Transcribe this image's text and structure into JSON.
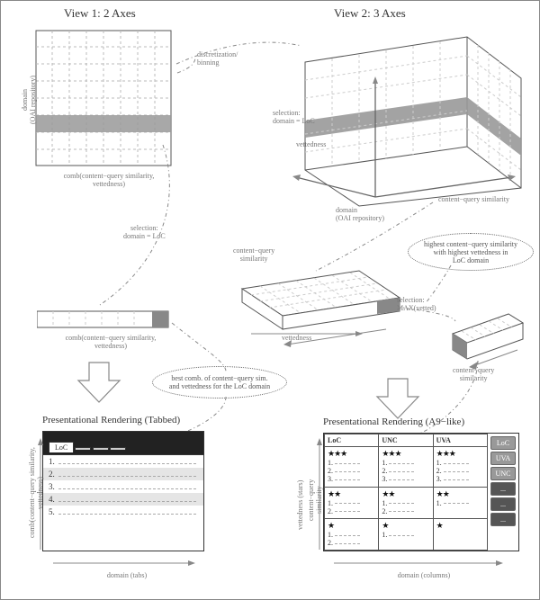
{
  "titles": {
    "view1": "View 1: 2 Axes",
    "view2": "View 2: 3 Axes"
  },
  "labels": {
    "domain_oai": "domain\n(OAI repository)",
    "comb_axis": "comb(content−query similarity,\nvettedness)",
    "discretization": "discretization/\nbinning",
    "selection_loc": "selection:\ndomain = LoC",
    "vettedness": "vettedness",
    "cqsim": "content−query similarity",
    "cqsim_short": "content−query\nsimilarity",
    "sel_max": "selection:\nMAX(vetted)",
    "vetted_stars": "vettedness (stars)",
    "domain_tabs": "domain (tabs)",
    "domain_columns": "domain (columns)",
    "tabbed_title": "Presentational Rendering (Tabbed)",
    "a9_title": "Presentational Rendering (A9−like)"
  },
  "ovals": {
    "best_comb": "best comb. of content−query sim.\nand vettedness for the LoC domain",
    "highest": "highest content−query similarity\nwith highest vettedness in\nLoC domain"
  },
  "tabbed": {
    "tabs": [
      "LoC",
      "",
      "",
      ""
    ],
    "rows": [
      "1.",
      "2.",
      "3.",
      "4.",
      "5."
    ]
  },
  "a9": {
    "columns": [
      "LoC",
      "UNC",
      "UVA"
    ],
    "side": [
      "LoC",
      "UVA",
      "UNC",
      "...",
      "...",
      "..."
    ],
    "cells": [
      [
        {
          "stars": 3,
          "items": [
            "1.",
            "2.",
            "3."
          ]
        },
        {
          "stars": 3,
          "items": [
            "1.",
            "2.",
            "3."
          ]
        },
        {
          "stars": 3,
          "items": [
            "1.",
            "2.",
            "3."
          ]
        }
      ],
      [
        {
          "stars": 2,
          "items": [
            "1.",
            "2."
          ]
        },
        {
          "stars": 2,
          "items": [
            "1.",
            "2."
          ]
        },
        {
          "stars": 2,
          "items": [
            "1."
          ]
        }
      ],
      [
        {
          "stars": 1,
          "items": [
            "1.",
            "2."
          ]
        },
        {
          "stars": 1,
          "items": [
            "1."
          ]
        },
        {
          "stars": 1,
          "items": []
        }
      ]
    ]
  }
}
